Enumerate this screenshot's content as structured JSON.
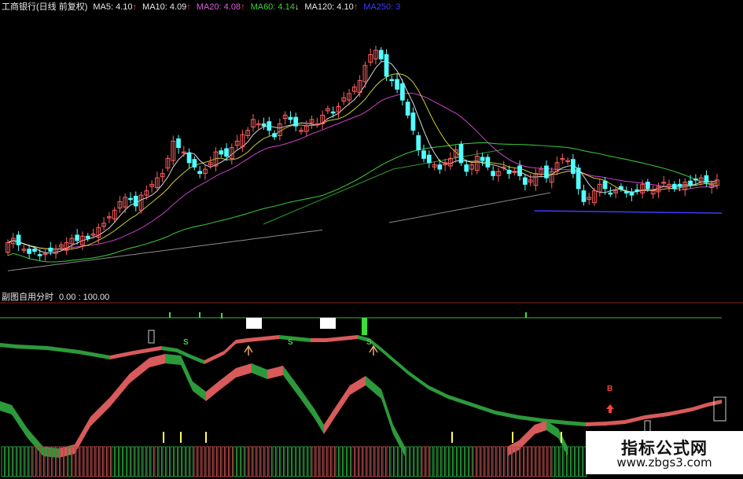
{
  "header": {
    "title": "工商银行(日线 前复权)",
    "ma5": "MA5: 4.10",
    "ma10": "MA10: 4.09",
    "ma20": "MA20: 4.08",
    "ma60": "MA60: 4.14",
    "ma120": "MA120: 4.10",
    "ma250": "MA250: 3",
    "arrow_up": "↑",
    "arrow_down": "↓"
  },
  "sub_header": {
    "title": "副图自用分时",
    "range": "0.00 : 100.00"
  },
  "signals": {
    "s": "S",
    "b": "B"
  },
  "watermark": {
    "title": "指标公式网",
    "url": "www.zbgs3.com"
  },
  "colors": {
    "up": "#ff5f5f",
    "down": "#54ffff",
    "ma5": "#ffffff",
    "ma10": "#ffff3c",
    "ma20": "#ff50ff",
    "ma60": "#3cd23c",
    "ma120": "#ffffff",
    "ma250": "#3c3cff",
    "osc_up": "#d85a5a",
    "osc_down": "#2c9a3a"
  },
  "chart_data": [
    {
      "type": "candlestick",
      "title": "工商银行(日线 前复权)",
      "indicators": [
        "MA5",
        "MA10",
        "MA20",
        "MA60",
        "MA120",
        "MA250"
      ],
      "close": [
        4.03,
        4.05,
        4.02,
        4.0,
        3.98,
        3.99,
        3.97,
        3.98,
        3.99,
        4.0,
        4.02,
        4.03,
        4.05,
        4.04,
        4.06,
        4.05,
        4.07,
        4.1,
        4.12,
        4.15,
        4.18,
        4.22,
        4.24,
        4.23,
        4.2,
        4.25,
        4.27,
        4.3,
        4.33,
        4.35,
        4.42,
        4.5,
        4.47,
        4.45,
        4.4,
        4.38,
        4.35,
        4.37,
        4.4,
        4.45,
        4.44,
        4.43,
        4.47,
        4.5,
        4.53,
        4.55,
        4.6,
        4.58,
        4.57,
        4.55,
        4.52,
        4.58,
        4.62,
        4.6,
        4.57,
        4.55,
        4.57,
        4.6,
        4.58,
        4.62,
        4.65,
        4.63,
        4.66,
        4.7,
        4.72,
        4.75,
        4.78,
        4.85,
        4.9,
        4.92,
        4.88,
        4.8,
        4.78,
        4.74,
        4.69,
        4.62,
        4.55,
        4.46,
        4.42,
        4.4,
        4.39,
        4.37,
        4.4,
        4.42,
        4.46,
        4.4,
        4.36,
        4.39,
        4.43,
        4.41,
        4.38,
        4.34,
        4.36,
        4.38,
        4.35,
        4.36,
        4.34,
        4.3,
        4.32,
        4.35,
        4.37,
        4.33,
        4.36,
        4.4,
        4.42,
        4.41,
        4.35,
        4.28,
        4.22,
        4.24,
        4.27,
        4.3,
        4.28,
        4.26,
        4.27,
        4.28,
        4.26,
        4.25,
        4.27,
        4.3,
        4.28,
        4.27,
        4.29,
        4.31,
        4.3,
        4.28,
        4.29,
        4.31,
        4.3,
        4.32,
        4.33,
        4.31,
        4.3,
        4.32
      ]
    },
    {
      "type": "line",
      "title": "副图自用分时",
      "ylim": [
        0,
        100
      ],
      "signals": [
        "S",
        "S",
        "S",
        "B"
      ]
    }
  ]
}
